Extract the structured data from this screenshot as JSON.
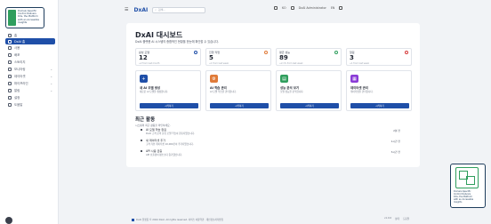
{
  "sidebar": {
    "brand_text": "Domain-Specific\nControl Delivers\nDXs, the Platform\nwith an Accessible Insights",
    "items": [
      {
        "label": "홈",
        "icon": "home-icon",
        "active": false
      },
      {
        "label": "DxAI 홈",
        "icon": "dashboard-icon",
        "active": true
      },
      {
        "label": "사용",
        "icon": "usage-icon",
        "active": false
      },
      {
        "label": "배포",
        "icon": "deploy-icon",
        "active": false
      },
      {
        "label": "스토리지",
        "icon": "storage-icon",
        "active": false
      },
      {
        "label": "모니터링",
        "icon": "monitor-icon",
        "active": false
      },
      {
        "label": "데이터셋",
        "icon": "dataset-icon",
        "active": false
      },
      {
        "label": "파이프라인",
        "icon": "pipeline-icon",
        "active": false
      },
      {
        "label": "알림",
        "icon": "bell-icon",
        "active": false
      },
      {
        "label": "설정",
        "icon": "gear-icon",
        "active": false
      },
      {
        "label": "도움말",
        "icon": "help-icon",
        "active": false
      }
    ]
  },
  "topbar": {
    "logo": "DxAI",
    "search_placeholder": "검색...",
    "items": [
      "KO",
      "DxAI Administrator",
      "EN"
    ]
  },
  "main": {
    "title": "DxAI 대시보드",
    "subtitle": "DxAI 플랫폼 AI 시스템의 종합적인 현황을 한눈에 확인할 수 있습니다.",
    "stats": [
      {
        "label": "활성 모델",
        "value": "12",
        "foot": "+2 from last month",
        "color": "#1f4fa8"
      },
      {
        "label": "진행 작업",
        "value": "5",
        "foot": "+1 from last week",
        "color": "#e07b39"
      },
      {
        "label": "평균 성능",
        "value": "89",
        "foot": "+2.1% from last week",
        "color": "#2f9e5d"
      },
      {
        "label": "알림",
        "value": "3",
        "foot": "+1 from last week",
        "color": "#d63b3b"
      }
    ],
    "actions": [
      {
        "title": "새 AI 모델 생성",
        "desc": "새로운 AI 모델을 생성합니다.",
        "button": "시작하기",
        "color": "#1f4fa8",
        "icon": "+"
      },
      {
        "title": "AI 학습 관리",
        "desc": "AI 모델 학습을 관리합니다.",
        "button": "시작하기",
        "color": "#e07b39",
        "icon": "⚙"
      },
      {
        "title": "성능 분석 보기",
        "desc": "모델 성능을 분석합니다.",
        "button": "시작하기",
        "color": "#2f9e5d",
        "icon": "▤"
      },
      {
        "title": "데이터셋 관리",
        "desc": "데이터셋을 관리합니다.",
        "button": "시작하기",
        "color": "#8a3bd6",
        "icon": "▦"
      }
    ],
    "recent": {
      "title": "최근 활동",
      "subtitle": "시스템의 최근 활동을 확인하세요.",
      "items": [
        {
          "name": "AI 모델 학습 완료",
          "desc": "DxAI 고객 문의 분류 모델 학습이 완료되었습니다.",
          "time": "2분 전"
        },
        {
          "name": "새 데이터셋 추가",
          "desc": "고객 리뷰 데이터셋 10,000건이 추가되었습니다.",
          "time": "1시간 전"
        },
        {
          "name": "API 사용 급증",
          "desc": "API 호출량이 평소보다 증가했습니다.",
          "time": "3시간 전"
        }
      ]
    }
  },
  "footer": {
    "text": "DxAI 플랫폼 © 2024 DxAI. All rights reserved. 서비스 이용약관 · 개인정보처리방침",
    "right_items": [
      "v1.0.0",
      "상태",
      "도움말"
    ]
  },
  "widget": {
    "text": "Domain-Specific\nControl Delivers\nDXs, the Platform\nwith an Accessible\nInsights"
  }
}
